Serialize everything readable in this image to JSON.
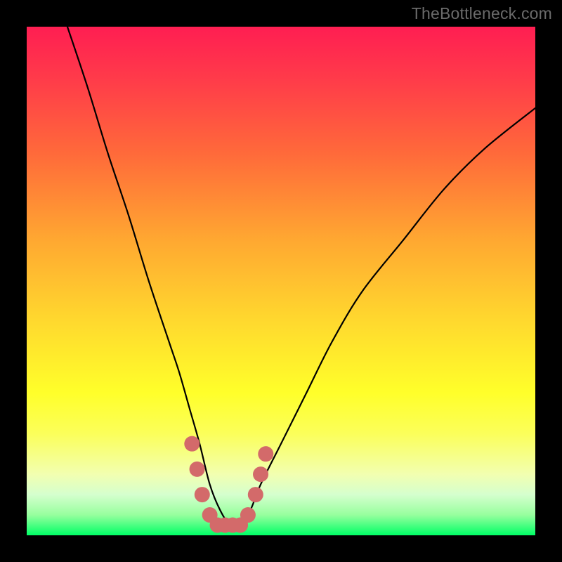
{
  "watermark": "TheBottleneck.com",
  "chart_data": {
    "type": "line",
    "title": "",
    "xlabel": "",
    "ylabel": "",
    "xlim": [
      0,
      100
    ],
    "ylim": [
      0,
      100
    ],
    "series": [
      {
        "name": "bottleneck-curve",
        "x": [
          8,
          12,
          16,
          20,
          24,
          28,
          30,
          32,
          34,
          36,
          38,
          40,
          42,
          44,
          46,
          50,
          55,
          60,
          66,
          74,
          82,
          90,
          100
        ],
        "y": [
          100,
          88,
          75,
          63,
          50,
          38,
          32,
          25,
          18,
          10,
          5,
          2,
          2,
          5,
          10,
          18,
          28,
          38,
          48,
          58,
          68,
          76,
          84
        ]
      }
    ],
    "highlight_dots": {
      "name": "highlighted-points",
      "color": "#d36a6a",
      "points": [
        {
          "x": 32.5,
          "y": 18
        },
        {
          "x": 33.5,
          "y": 13
        },
        {
          "x": 34.5,
          "y": 8
        },
        {
          "x": 36.0,
          "y": 4
        },
        {
          "x": 37.5,
          "y": 2
        },
        {
          "x": 39.0,
          "y": 2
        },
        {
          "x": 40.5,
          "y": 2
        },
        {
          "x": 42.0,
          "y": 2
        },
        {
          "x": 43.5,
          "y": 4
        },
        {
          "x": 45.0,
          "y": 8
        },
        {
          "x": 46.0,
          "y": 12
        },
        {
          "x": 47.0,
          "y": 16
        }
      ]
    },
    "gradient_stops": [
      {
        "pos": 0,
        "color": "#ff1e52"
      },
      {
        "pos": 10,
        "color": "#ff3a4a"
      },
      {
        "pos": 25,
        "color": "#ff6a3a"
      },
      {
        "pos": 42,
        "color": "#ffa831"
      },
      {
        "pos": 58,
        "color": "#ffd92e"
      },
      {
        "pos": 72,
        "color": "#ffff2a"
      },
      {
        "pos": 80,
        "color": "#fbff5a"
      },
      {
        "pos": 88,
        "color": "#f2ffb0"
      },
      {
        "pos": 92,
        "color": "#d5ffce"
      },
      {
        "pos": 96,
        "color": "#97ff9e"
      },
      {
        "pos": 100,
        "color": "#00ff66"
      }
    ]
  }
}
